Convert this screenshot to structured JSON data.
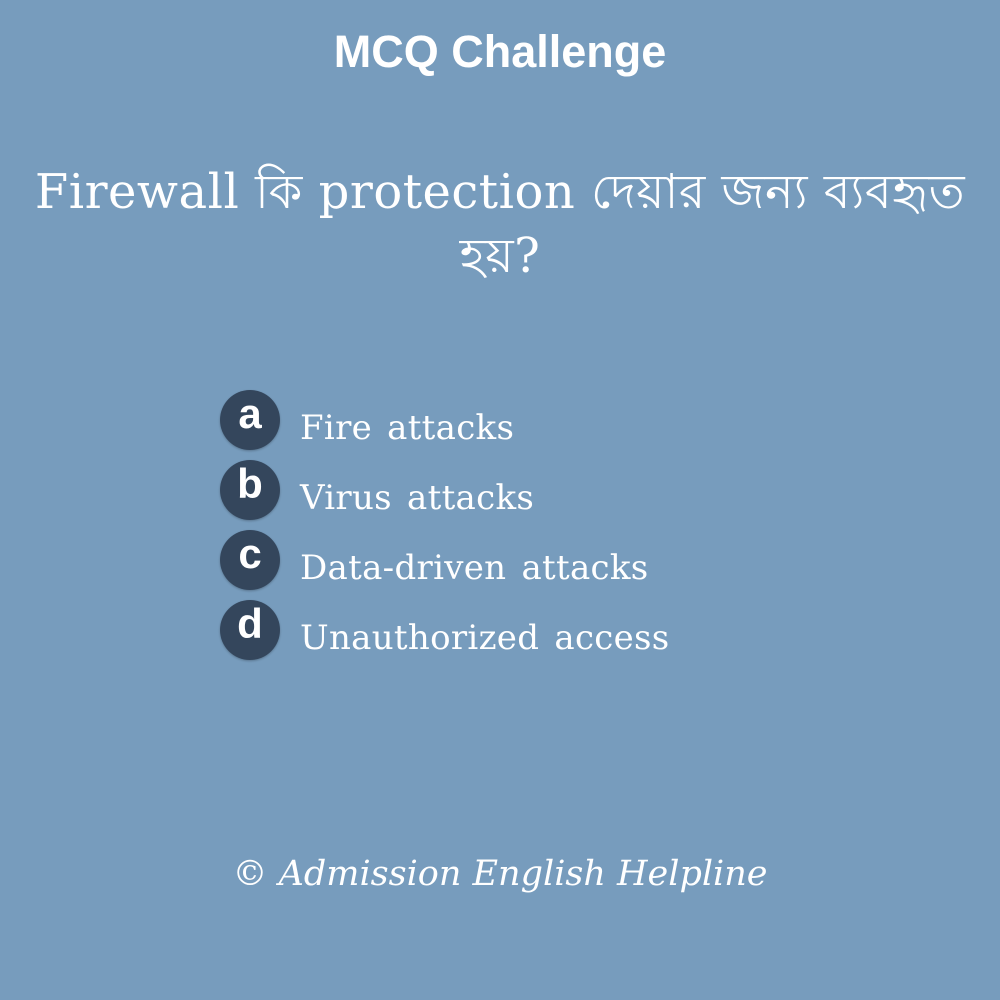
{
  "header": {
    "title": "MCQ Challenge"
  },
  "question": {
    "line1": "Firewall কি protection দেয়ার জন্য ব্যবহৃত",
    "line2": "হয়?"
  },
  "options": [
    {
      "letter": "a",
      "text": "Fire attacks"
    },
    {
      "letter": "b",
      "text": "Virus attacks"
    },
    {
      "letter": "c",
      "text": "Data-driven attacks"
    },
    {
      "letter": "d",
      "text": "Unauthorized access"
    }
  ],
  "footer": {
    "credit": "© Admission English Helpline"
  },
  "colors": {
    "background": "#779cbd",
    "badge": "#34465c",
    "text": "#ffffff"
  }
}
